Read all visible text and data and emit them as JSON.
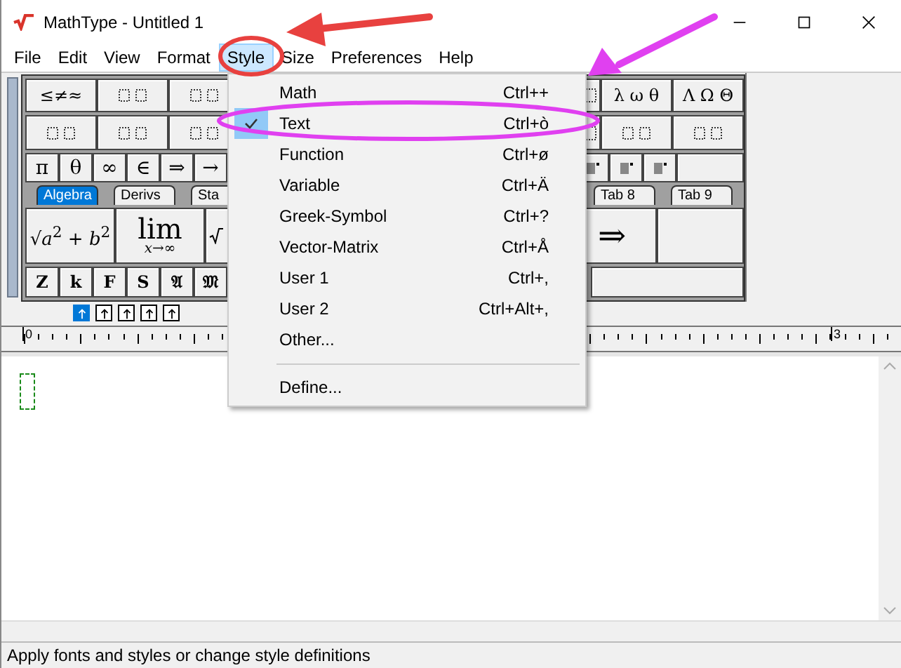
{
  "window": {
    "title": "MathType - Untitled 1"
  },
  "menu_bar": [
    {
      "label": "File",
      "selected": false
    },
    {
      "label": "Edit",
      "selected": false
    },
    {
      "label": "View",
      "selected": false
    },
    {
      "label": "Format",
      "selected": false
    },
    {
      "label": "Style",
      "selected": true
    },
    {
      "label": "Size",
      "selected": false
    },
    {
      "label": "Preferences",
      "selected": false
    },
    {
      "label": "Help",
      "selected": false
    }
  ],
  "palette": {
    "symbol_rows": [
      {
        "left": [
          {
            "kind": "text",
            "text": "≤≠≈"
          },
          {
            "kind": "icon"
          },
          {
            "kind": "icon"
          }
        ],
        "right": [
          {
            "kind": "icon"
          },
          {
            "kind": "text",
            "text": "λ ω θ"
          },
          {
            "kind": "text",
            "text": "Λ Ω Θ"
          }
        ]
      },
      {
        "left": [
          {
            "kind": "icon"
          },
          {
            "kind": "icon"
          },
          {
            "kind": "icon"
          }
        ],
        "right": [
          {
            "kind": "icon"
          },
          {
            "kind": "icon"
          },
          {
            "kind": "icon"
          }
        ]
      }
    ],
    "small_row": {
      "left": [
        {
          "kind": "text",
          "text": "π"
        },
        {
          "kind": "text",
          "text": "θ"
        },
        {
          "kind": "text",
          "text": "∞"
        },
        {
          "kind": "text",
          "text": "∈"
        },
        {
          "kind": "text",
          "text": "⇒"
        },
        {
          "kind": "text",
          "text": "→"
        }
      ],
      "right": [
        {
          "kind": "icon"
        },
        {
          "kind": "icon"
        },
        {
          "kind": "icon"
        },
        {
          "kind": "blank"
        }
      ]
    },
    "tabs": {
      "left": [
        {
          "label": "Algebra",
          "selected": true
        },
        {
          "label": "Derivs",
          "selected": false
        },
        {
          "label": "Sta",
          "selected": false
        }
      ],
      "right": [
        {
          "label": "Tab 8",
          "selected": false
        },
        {
          "label": "Tab 9",
          "selected": false
        }
      ]
    },
    "template_row": {
      "left": [
        {
          "kind": "formula",
          "text": "√*a*$^{2}$ + *b*$^{2}$"
        },
        {
          "kind": "limit",
          "text": "lim",
          "sub": "x→∞"
        },
        {
          "kind": "icon"
        }
      ],
      "right": [
        {
          "kind": "text",
          "text": "⇒"
        },
        {
          "kind": "blank"
        }
      ]
    },
    "style_row": {
      "left": [
        {
          "kind": "text",
          "text": "Z"
        },
        {
          "kind": "text",
          "text": "k"
        },
        {
          "kind": "text",
          "text": "F"
        },
        {
          "kind": "text",
          "text": "S"
        },
        {
          "kind": "text",
          "text": "𝔄"
        },
        {
          "kind": "text",
          "text": "𝔐"
        }
      ],
      "right": [
        {
          "kind": "blank"
        }
      ]
    }
  },
  "alignment_buttons": [
    {
      "selected": true
    },
    {
      "selected": false
    },
    {
      "selected": false
    },
    {
      "selected": false
    },
    {
      "selected": false
    }
  ],
  "ruler": {
    "marks": [
      "0",
      "3"
    ]
  },
  "style_menu": [
    {
      "kind": "item",
      "label": "Math",
      "shortcut": "Ctrl++",
      "checked": false
    },
    {
      "kind": "item",
      "label": "Text",
      "shortcut": "Ctrl+ò",
      "checked": true
    },
    {
      "kind": "item",
      "label": "Function",
      "shortcut": "Ctrl+ø",
      "checked": false
    },
    {
      "kind": "item",
      "label": "Variable",
      "shortcut": "Ctrl+Ä",
      "checked": false
    },
    {
      "kind": "item",
      "label": "Greek-Symbol",
      "shortcut": "Ctrl+?",
      "checked": false
    },
    {
      "kind": "item",
      "label": "Vector-Matrix",
      "shortcut": "Ctrl+Å",
      "checked": false
    },
    {
      "kind": "item",
      "label": "User 1",
      "shortcut": "Ctrl+,",
      "checked": false
    },
    {
      "kind": "item",
      "label": "User 2",
      "shortcut": "Ctrl+Alt+,",
      "checked": false
    },
    {
      "kind": "item",
      "label": "Other...",
      "checked": false
    },
    {
      "kind": "separator"
    },
    {
      "kind": "item",
      "label": "Define...",
      "checked": false
    }
  ],
  "status_bar": {
    "text": "Apply fonts and styles or change style definitions"
  }
}
